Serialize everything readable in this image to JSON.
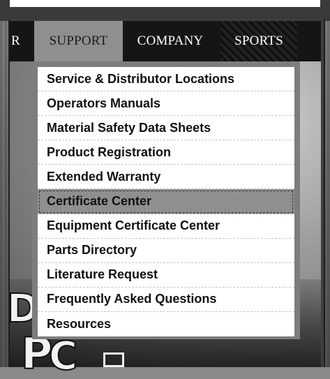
{
  "nav": {
    "items": [
      {
        "label": "R",
        "state": "partial"
      },
      {
        "label": "SUPPORT",
        "state": "active"
      },
      {
        "label": "COMPANY",
        "state": "normal"
      },
      {
        "label": "SPORTS",
        "state": "normal"
      }
    ]
  },
  "support_menu": {
    "items": [
      {
        "label": "Service & Distributor Locations"
      },
      {
        "label": "Operators Manuals"
      },
      {
        "label": "Material Safety Data Sheets"
      },
      {
        "label": "Product Registration"
      },
      {
        "label": "Extended Warranty"
      },
      {
        "label": "Certificate Center"
      },
      {
        "label": "Equipment Certificate Center"
      },
      {
        "label": "Parts Directory"
      },
      {
        "label": "Literature Request"
      },
      {
        "label": "Frequently Asked Questions"
      },
      {
        "label": "Resources"
      }
    ],
    "highlighted": "Certificate Center"
  },
  "background_letters": [
    "D",
    "P",
    "C"
  ],
  "colors": {
    "nav_bg": "#151515",
    "nav_active_bg": "#8f8f8f",
    "menu_highlight_bg": "#8f8f8f",
    "menu_bg": "#ffffff"
  }
}
